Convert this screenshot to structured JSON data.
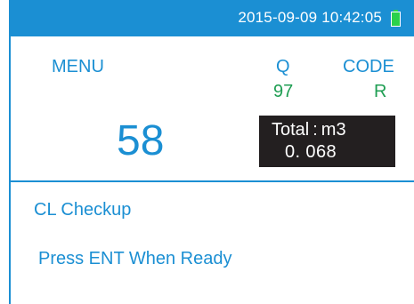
{
  "status_bar": {
    "datetime": "2015-09-09 10:42:05",
    "battery_icon": "battery-full-icon",
    "battery_color": "#2ad14b"
  },
  "header": {
    "menu_label": "MENU",
    "q_label": "Q",
    "q_value": "97",
    "code_label": "CODE",
    "code_value": "R"
  },
  "reading": {
    "value": "58",
    "total_label": "Total : m3",
    "total_value": "0. 068"
  },
  "message": {
    "title": "CL Checkup",
    "prompt": "Press ENT  When Ready"
  },
  "colors": {
    "accent": "#1b8fd3",
    "green": "#1f9e53",
    "dark_box": "#231f20"
  }
}
